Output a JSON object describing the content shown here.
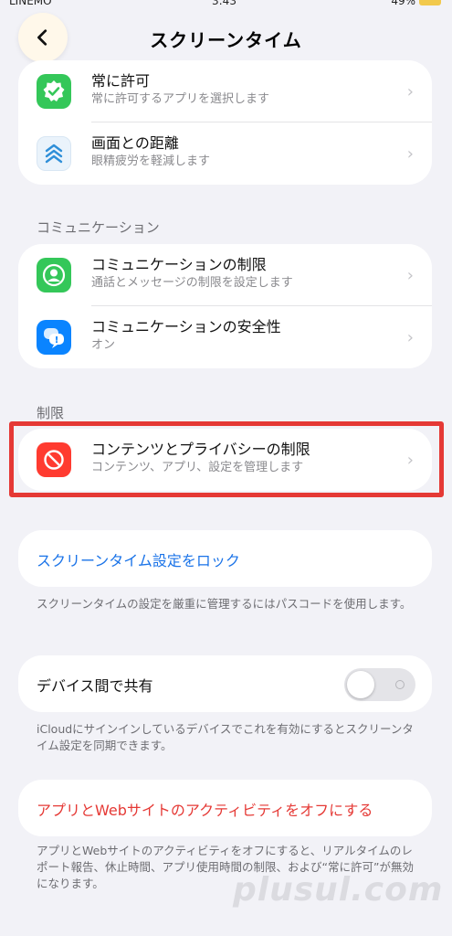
{
  "status": {
    "carrier": "LINEMO",
    "time": "3:43",
    "battery": "49%"
  },
  "nav": {
    "title": "スクリーンタイム"
  },
  "group1": [
    {
      "title": "常に許可",
      "subtitle": "常に許可するアプリを選択します",
      "icon": "checkmark-badge-icon",
      "color": "#34c759"
    },
    {
      "title": "画面との距離",
      "subtitle": "眼精疲労を軽減します",
      "icon": "chevrons-up-icon",
      "color": "#eaf3fb"
    }
  ],
  "communication": {
    "header": "コミュニケーション",
    "items": [
      {
        "title": "コミュニケーションの制限",
        "subtitle": "通話とメッセージの制限を設定します",
        "icon": "person-circle-icon",
        "color": "#34c759"
      },
      {
        "title": "コミュニケーションの安全性",
        "subtitle": "オン",
        "icon": "message-bubbles-icon",
        "color": "#0a84ff"
      }
    ]
  },
  "restrictions": {
    "header": "制限",
    "items": [
      {
        "title": "コンテンツとプライバシーの制限",
        "subtitle": "コンテンツ、アプリ、設定を管理します",
        "icon": "prohibited-icon",
        "color": "#ff3b30"
      }
    ]
  },
  "lock": {
    "label": "スクリーンタイム設定をロック",
    "footnote": "スクリーンタイムの設定を厳重に管理するにはパスコードを使用します。"
  },
  "share": {
    "label": "デバイス間で共有",
    "enabled": false,
    "footnote": "iCloudにサインインしているデバイスでこれを有効にするとスクリーンタイム設定を同期できます。"
  },
  "activity": {
    "label": "アプリとWebサイトのアクティビティをオフにする",
    "footnote": "アプリとWebサイトのアクティビティをオフにすると、リアルタイムのレポート報告、休止時間、アプリ使用時間の制限、および“常に許可”が無効になります。"
  },
  "watermark": "plusul.com",
  "colors": {
    "link": "#1a73e8",
    "destructive": "#e53935",
    "highlight": "#e53935"
  }
}
